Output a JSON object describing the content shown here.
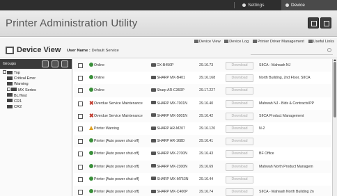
{
  "topbar": {
    "settings_label": "Settings",
    "device_mgmt_label": "Device Management"
  },
  "header": {
    "title": "Printer Administration Utility"
  },
  "view": {
    "title": "Device View",
    "user_label": "User Name :",
    "user_value": "Default Service",
    "links": {
      "device_view": "Device View",
      "device_log": "Device Log",
      "driver_mgmt": "Printer Driver Management",
      "useful_links": "Useful Links"
    }
  },
  "sidebar": {
    "header": "Groups",
    "tree": [
      {
        "label": "Top",
        "level": 0,
        "toggle": "-"
      },
      {
        "label": "Critical Error",
        "level": 1
      },
      {
        "label": "Warning",
        "level": 1
      },
      {
        "label": "MX Series",
        "level": 1,
        "toggle": "+"
      },
      {
        "label": "BL/Test",
        "level": 1
      },
      {
        "label": "CR1",
        "level": 1
      },
      {
        "label": "CR2",
        "level": 1
      }
    ]
  },
  "grid": {
    "download_label": "Download",
    "rows": [
      {
        "status": "ok",
        "status_text": "Online",
        "model": "DX-B450P",
        "ip": "29.16.73",
        "location": "SIICA - Mahwah NJ"
      },
      {
        "status": "ok",
        "status_text": "Online",
        "model": "SHARP MX-B401",
        "ip": "29.16.168",
        "location": "North Building, 2nd Floor, SIICA"
      },
      {
        "status": "ok",
        "status_text": "Online",
        "model": "Sharp AR-C360P",
        "ip": "29.17.227",
        "location": ""
      },
      {
        "status": "err",
        "status_text": "Overdue Service Maintenance",
        "model": "SHARP MX-7001N",
        "ip": "29.16.40",
        "location": "Mahwah NJ - Bids & Contracts/PP"
      },
      {
        "status": "err",
        "status_text": "Overdue Service Maintenance",
        "model": "SHARP MX-5001N",
        "ip": "29.16.42",
        "location": "SIICA Product Management"
      },
      {
        "status": "warn",
        "status_text": "Printer Warning",
        "model": "SHARP AR-M207",
        "ip": "29.16.120",
        "location": "N-2"
      },
      {
        "status": "ok",
        "status_text": "Printer [Auto power shut-off]",
        "model": "SHARP AR-168D",
        "ip": "29.16.41",
        "location": ""
      },
      {
        "status": "ok",
        "status_text": "Printer [Auto power shut-off]",
        "model": "SHARP MX-2700N",
        "ip": "29.16.43",
        "location": "BF Office"
      },
      {
        "status": "ok",
        "status_text": "Printer [Auto power shut-off]",
        "model": "SHARP MX-2300N",
        "ip": "29.16.69",
        "location": "Mahwah North Product Managem"
      },
      {
        "status": "ok",
        "status_text": "Printer [Auto power shut-off]",
        "model": "SHARP MX-M753N",
        "ip": "29.16.44",
        "location": ""
      },
      {
        "status": "ok",
        "status_text": "Printer [Auto power shut-off]",
        "model": "SHARP MX-C400P",
        "ip": "29.16.74",
        "location": "SIICA - Mahwah North Building 2n"
      }
    ]
  }
}
